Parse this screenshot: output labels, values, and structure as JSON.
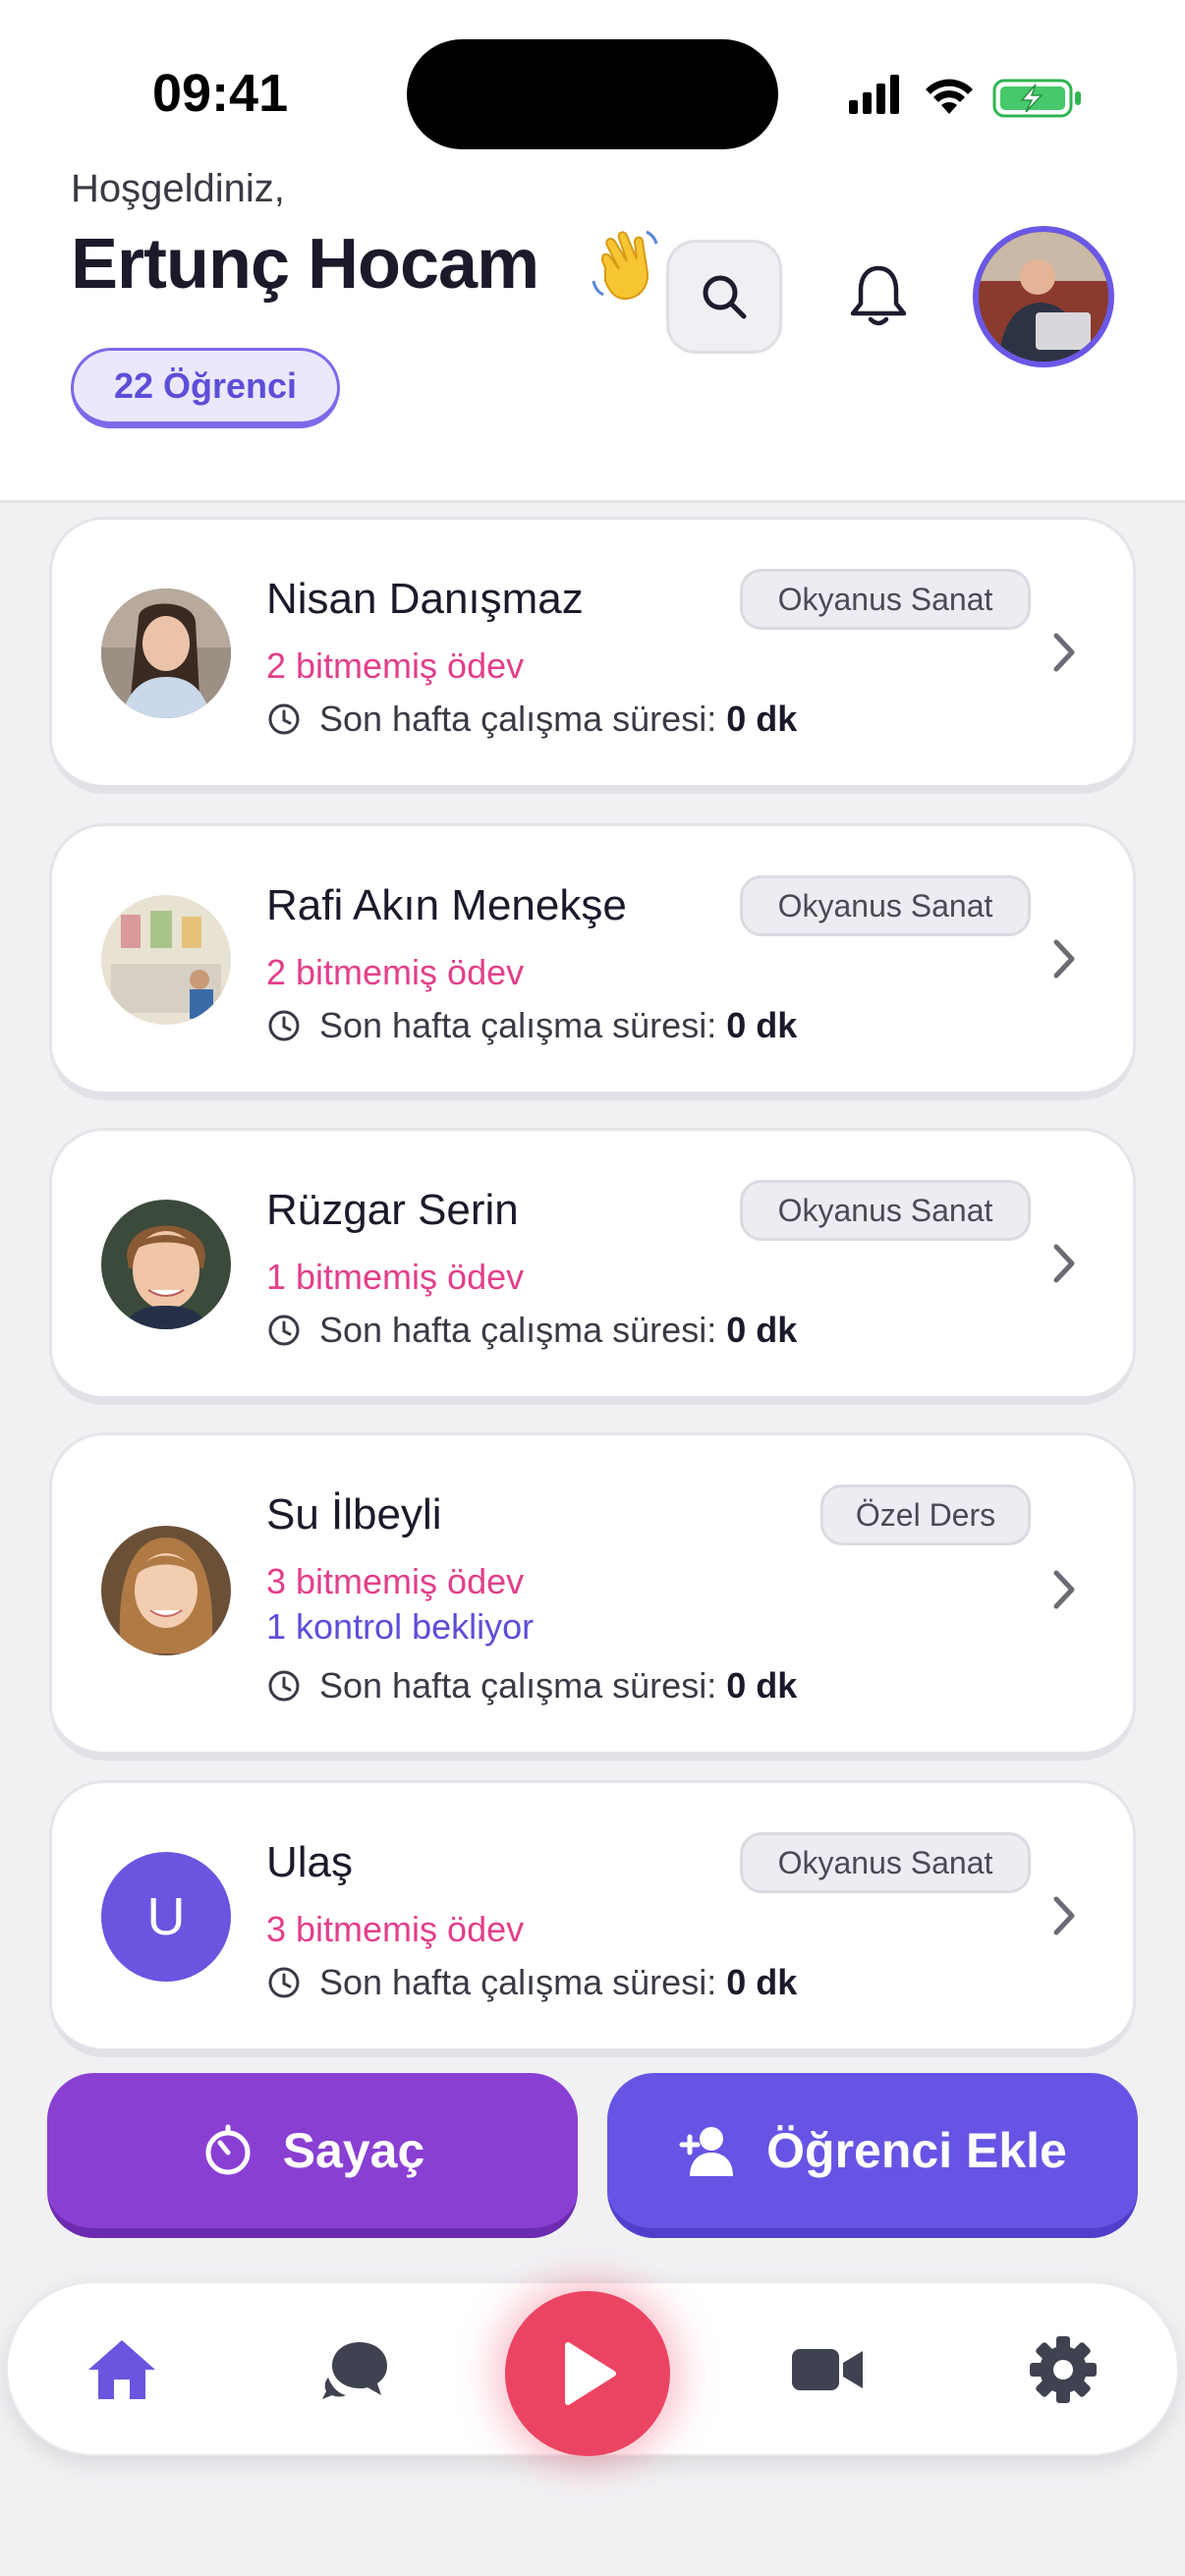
{
  "status_bar": {
    "time": "09:41"
  },
  "header": {
    "greeting": "Hoşgeldiniz,",
    "teacher_name": "Ertunç Hocam",
    "student_count": "22 Öğrenci"
  },
  "students": [
    {
      "name": "Nisan Danışmaz",
      "group": "Okyanus Sanat",
      "unfinished": "2 bitmemiş ödev",
      "pending": "",
      "study_label": "Son hafta çalışma süresi:",
      "study_value": "0 dk"
    },
    {
      "name": "Rafi Akın Menekşe",
      "group": "Okyanus Sanat",
      "unfinished": "2 bitmemiş ödev",
      "pending": "",
      "study_label": "Son hafta çalışma süresi:",
      "study_value": "0 dk"
    },
    {
      "name": "Rüzgar Serin",
      "group": "Okyanus Sanat",
      "unfinished": "1 bitmemiş ödev",
      "pending": "",
      "study_label": "Son hafta çalışma süresi:",
      "study_value": "0 dk"
    },
    {
      "name": "Su İlbeyli",
      "group": "Özel Ders",
      "unfinished": "3 bitmemiş ödev",
      "pending": "1 kontrol bekliyor",
      "study_label": "Son hafta çalışma süresi:",
      "study_value": "0 dk"
    },
    {
      "name": "Ulaş",
      "initial": "U",
      "group": "Okyanus Sanat",
      "unfinished": "3 bitmemiş ödev",
      "pending": "",
      "study_label": "Son hafta çalışma süresi:",
      "study_value": "0 dk"
    }
  ],
  "actions": {
    "timer_label": "Sayaç",
    "add_student_label": "Öğrenci Ekle"
  },
  "nav": {
    "items": [
      "home-icon",
      "chat-icon",
      "play-icon",
      "video-icon",
      "settings-icon"
    ],
    "active": "home-icon"
  },
  "colors": {
    "accent": "#6655e4",
    "timer": "#8a3fd3",
    "homework": "#e23f8a",
    "play": "#eb4462"
  }
}
